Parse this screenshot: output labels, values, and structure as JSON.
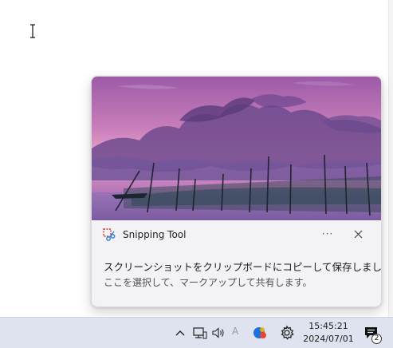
{
  "toast": {
    "app_name": "Snipping Tool",
    "more_label": "···",
    "title": "スクリーンショットをクリップボードにコピーして保存しました",
    "body": "ここを選択して、マークアップして共有します。"
  },
  "taskbar": {
    "time": "15:45:21",
    "date": "2024/07/01",
    "notification_count": "2",
    "ime_indicator": "A"
  },
  "icons": {
    "cursor": "text-cursor-icon",
    "app": "snipping-tool-icon",
    "close": "close-icon",
    "chevron": "chevron-up-icon",
    "network": "network-icon",
    "volume": "volume-icon",
    "copilot": "copilot-icon",
    "settings": "gear-icon",
    "notifications": "notification-icon"
  }
}
